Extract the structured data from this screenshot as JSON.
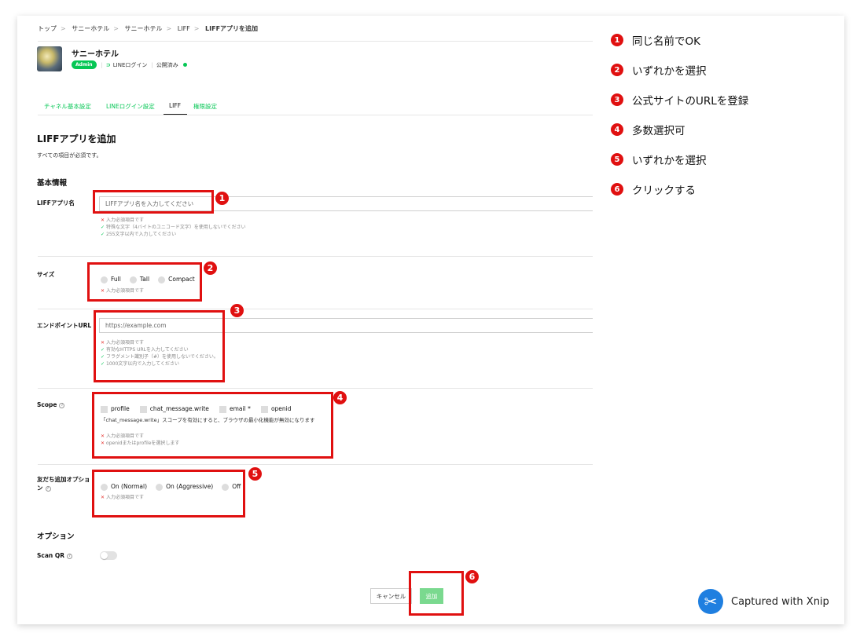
{
  "breadcrumb": [
    "トップ",
    "サニーホテル",
    "サニーホテル",
    "LIFF",
    "LIFFアプリを追加"
  ],
  "channel": {
    "name": "サニーホテル",
    "badge": "Admin",
    "login_type": "LINEログイン",
    "status": "公開済み"
  },
  "tabs": [
    "チャネル基本設定",
    "LINEログイン設定",
    "LIFF",
    "権限設定"
  ],
  "page": {
    "title": "LIFFアプリを追加",
    "subtitle": "すべての項目が必須です。",
    "section_basic": "基本情報",
    "section_options": "オプション"
  },
  "fields": {
    "app_name": {
      "label": "LIFFアプリ名",
      "placeholder": "LIFFアプリ名を入力してください",
      "hints": [
        "入力必須項目です",
        "特殊な文字（4バイトのユニコード文字）を使用しないでください",
        "255文字以内で入力してください"
      ]
    },
    "size": {
      "label": "サイズ",
      "options": [
        "Full",
        "Tall",
        "Compact"
      ],
      "hint": "入力必須項目です"
    },
    "endpoint": {
      "label": "エンドポイントURL",
      "placeholder": "https://example.com",
      "hints": [
        "入力必須項目です",
        "有効なHTTPS URLを入力してください",
        "フラグメント識別子（#）を使用しないでください。",
        "1000文字以内で入力してください"
      ]
    },
    "scope": {
      "label": "Scope",
      "options": [
        "profile",
        "chat_message.write",
        "email *",
        "openid"
      ],
      "note": "「chat_message.write」スコープを有効にすると、ブラウザの最小化機能が無効になります",
      "hints": [
        "入力必須項目です",
        "openidまたはprofileを選択します"
      ]
    },
    "friend": {
      "label_line1": "友だち追加オプショ",
      "label_line2": "ン",
      "options": [
        "On (Normal)",
        "On (Aggressive)",
        "Off"
      ],
      "hint": "入力必須項目です"
    },
    "scan_qr": {
      "label": "Scan QR"
    }
  },
  "buttons": {
    "cancel": "キャンセル",
    "add": "追加"
  },
  "callout_numbers": [
    "1",
    "2",
    "3",
    "4",
    "5",
    "6"
  ],
  "notes": [
    {
      "num": "1",
      "text": "同じ名前でOK"
    },
    {
      "num": "2",
      "text": "いずれかを選択"
    },
    {
      "num": "3",
      "text": "公式サイトのURLを登録"
    },
    {
      "num": "4",
      "text": "多数選択可"
    },
    {
      "num": "5",
      "text": "いずれかを選択"
    },
    {
      "num": "6",
      "text": "クリックする"
    }
  ],
  "watermark": "Captured with Xnip",
  "colors": {
    "accent": "#06c755",
    "annotation_red": "#e01010",
    "add_button": "#7ad98f",
    "xnip_blue": "#1f7fe0"
  }
}
